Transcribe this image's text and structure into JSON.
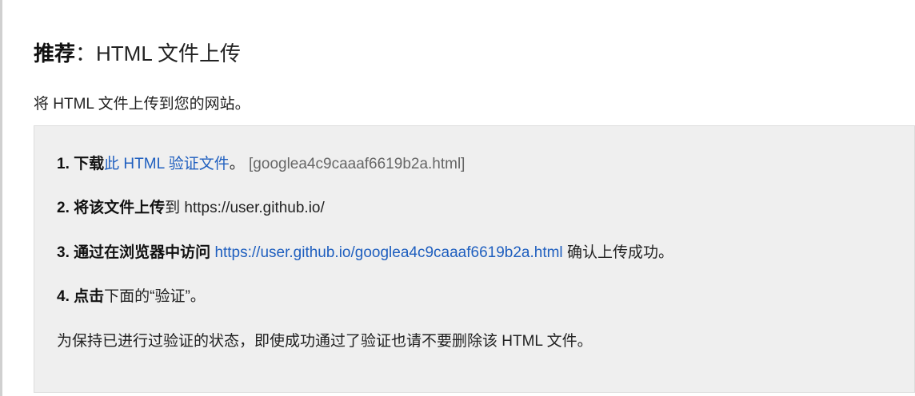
{
  "heading": {
    "strong": "推荐",
    "rest": "：HTML 文件上传"
  },
  "description": "将 HTML 文件上传到您的网站。",
  "steps": [
    {
      "number": "1.",
      "action": "下载",
      "link_text": "此 HTML 验证文件",
      "after": "。",
      "filename": "[googlea4c9caaaf6619b2a.html]"
    },
    {
      "number": "2.",
      "action": "将该文件上传",
      "after": "到 https://user.github.io/"
    },
    {
      "number": "3.",
      "action": "通过在浏览器中访问",
      "link_text": "https://user.github.io/googlea4c9caaaf6619b2a.html",
      "after": "确认上传成功。"
    },
    {
      "number": "4.",
      "action": "点击",
      "after": "下面的“验证”。"
    }
  ],
  "note": "为保持已进行过验证的状态，即使成功通过了验证也请不要删除该 HTML 文件。",
  "colors": {
    "link": "#1f5fbf",
    "panel_bg": "#efefef"
  }
}
